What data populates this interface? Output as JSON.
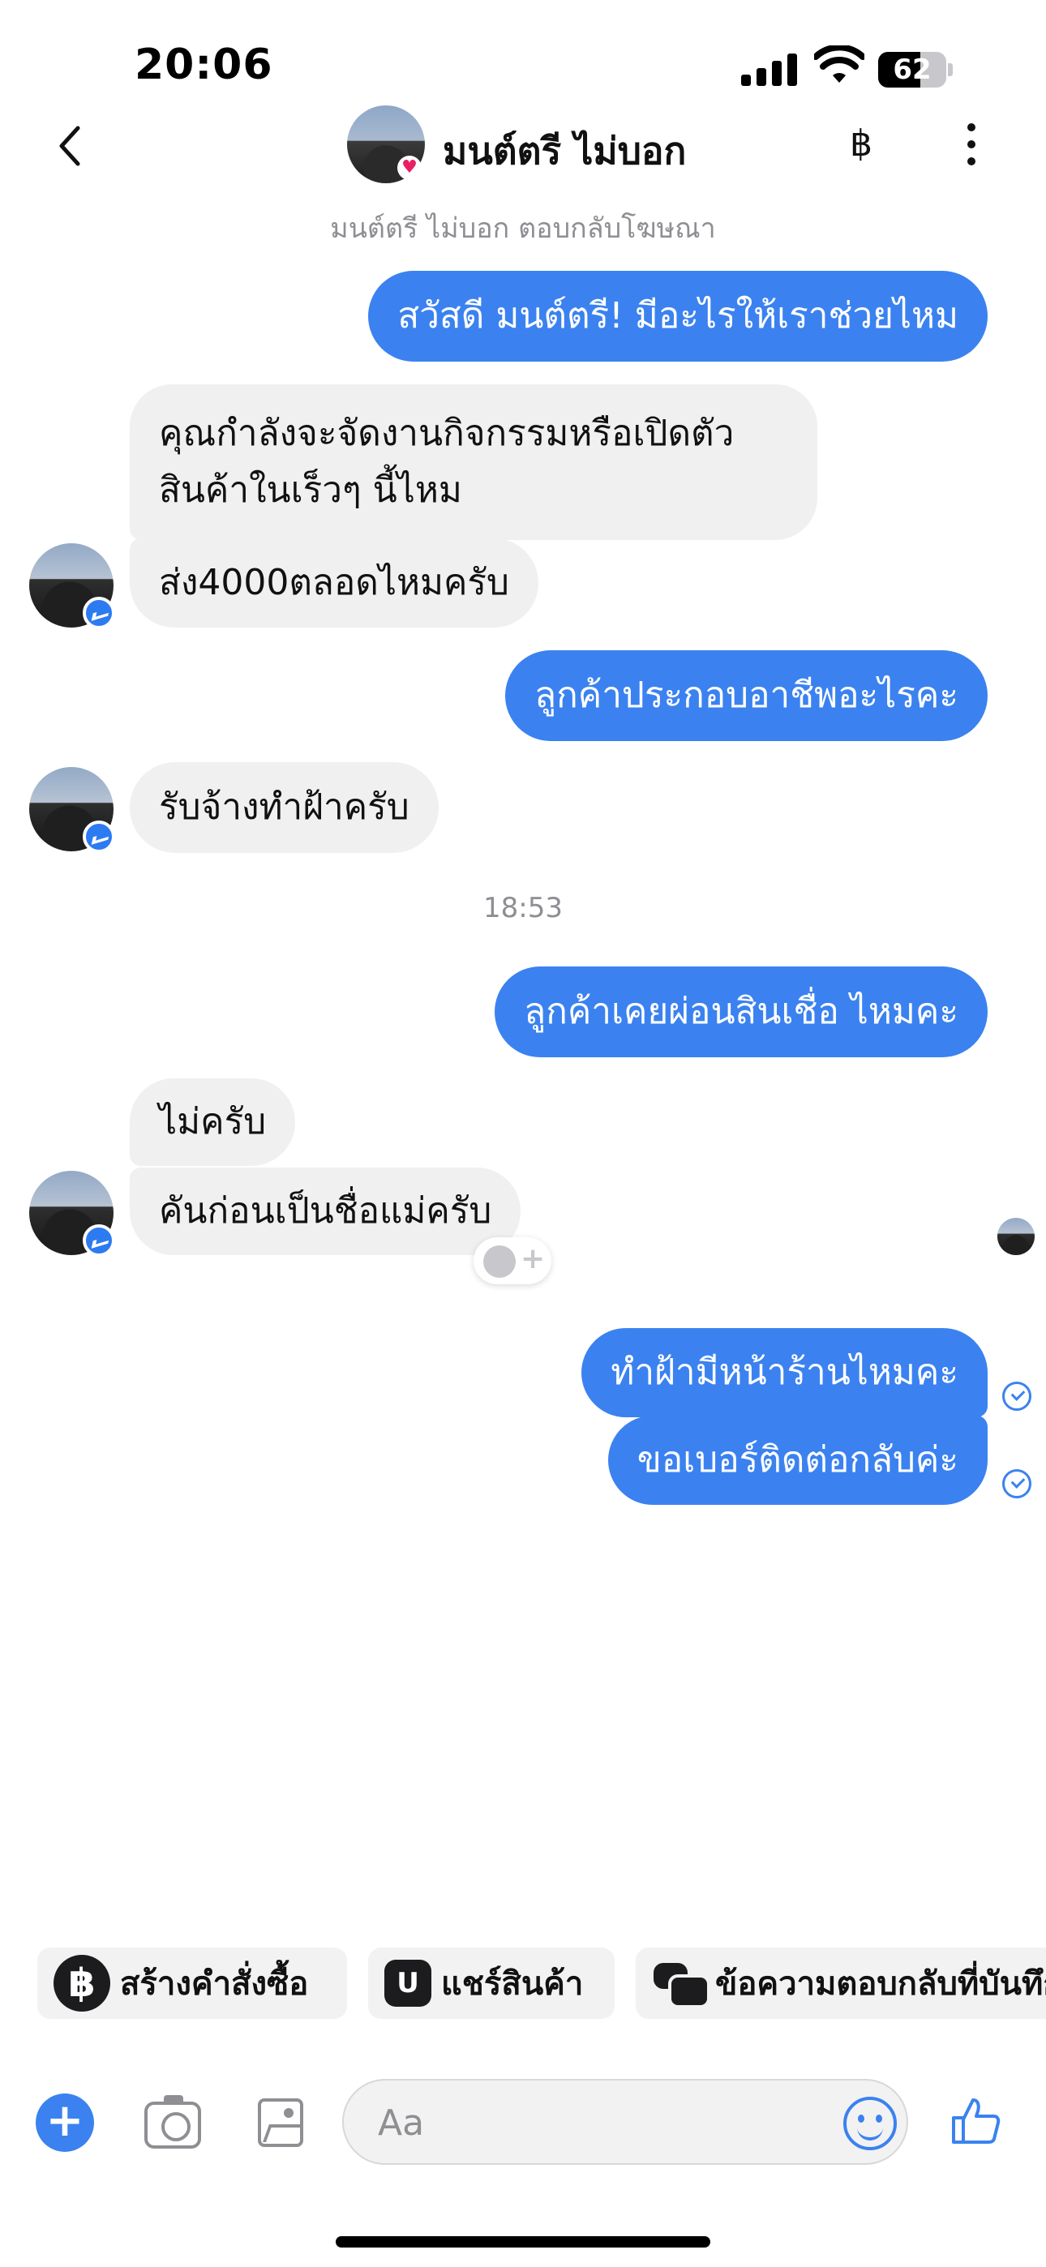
{
  "status_bar": {
    "time": "20:06",
    "battery": "62",
    "battery_level": 0.62
  },
  "header": {
    "name": "มนต์ตรี ไม่บอก",
    "currency_symbol": "฿",
    "subtitle": "มนต์ตรี ไม่บอก ตอบกลับโฆษณา"
  },
  "messages": [
    {
      "from": "me",
      "text": "สวัสดี มนต์ตรี! มีอะไรให้เราช่วยไหม"
    },
    {
      "from": "them",
      "text": "คุณกำลังจะจัดงานกิจกรรมหรือเปิดตัวสินค้าในเร็วๆ นี้ไหม"
    },
    {
      "from": "them",
      "text": "ส่ง4000ตลอดไหมครับ"
    },
    {
      "from": "me",
      "text": "ลูกค้าประกอบอาชีพอะไรคะ"
    },
    {
      "from": "them",
      "text": "รับจ้างทำฝ้าครับ"
    },
    {
      "from": "me",
      "text": "ลูกค้าเคยผ่อนสินเชื่อ ไหมคะ"
    },
    {
      "from": "them",
      "text": "ไม่ครับ"
    },
    {
      "from": "them",
      "text": "คันก่อนเป็นชื่อแม่ครับ"
    },
    {
      "from": "me",
      "text": "ทำฝ้ามีหน้าร้านไหมคะ"
    },
    {
      "from": "me",
      "text": "ขอเบอร์ติดต่อกลับค่ะ"
    }
  ],
  "timestamp": "18:53",
  "quick_actions": [
    {
      "icon": "baht-icon",
      "label": "สร้างคำสั่งซื้อ"
    },
    {
      "icon": "shop-bag-icon",
      "label": "แชร์สินค้า"
    },
    {
      "icon": "chat-bubbles-icon",
      "label": "ข้อความตอบกลับที่บันทึก"
    }
  ],
  "composer": {
    "placeholder": "Aa"
  },
  "colors": {
    "accent": "#3b82f0",
    "incoming_bubble": "#f0f0f0"
  }
}
